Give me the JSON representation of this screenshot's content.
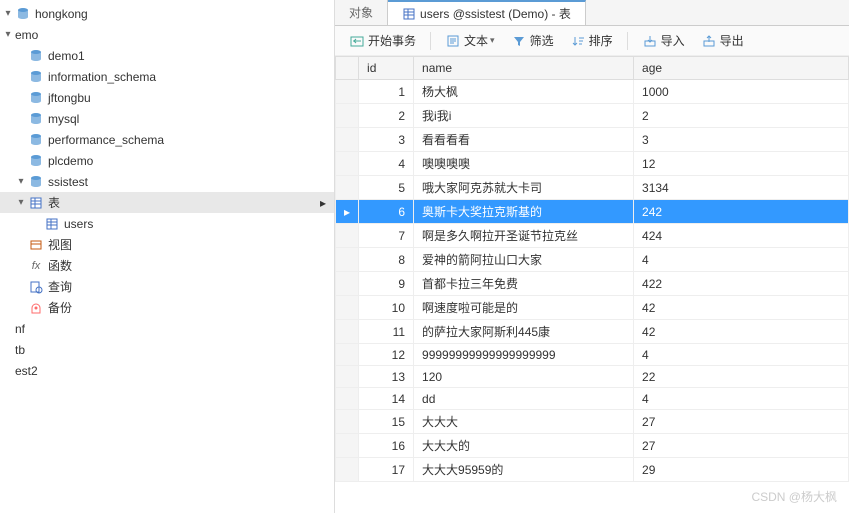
{
  "sidebar": {
    "items": [
      {
        "label": "hongkong",
        "icon": "db",
        "indent": 0,
        "arrow": "▾"
      },
      {
        "label": "emo",
        "icon": "",
        "indent": 0,
        "arrow": "▾"
      },
      {
        "label": "demo1",
        "icon": "db",
        "indent": 1,
        "arrow": ""
      },
      {
        "label": "information_schema",
        "icon": "db",
        "indent": 1,
        "arrow": ""
      },
      {
        "label": "jftongbu",
        "icon": "db",
        "indent": 1,
        "arrow": ""
      },
      {
        "label": "mysql",
        "icon": "db",
        "indent": 1,
        "arrow": ""
      },
      {
        "label": "performance_schema",
        "icon": "db",
        "indent": 1,
        "arrow": ""
      },
      {
        "label": "plcdemo",
        "icon": "db",
        "indent": 1,
        "arrow": ""
      },
      {
        "label": "ssistest",
        "icon": "db",
        "indent": 1,
        "arrow": "▾"
      },
      {
        "label": "表",
        "icon": "table-cat",
        "indent": 1,
        "arrow": "▾",
        "selected": true,
        "indicator": "▸"
      },
      {
        "label": "users",
        "icon": "table-cat",
        "indent": 2,
        "arrow": ""
      },
      {
        "label": "视图",
        "icon": "view",
        "indent": 1,
        "arrow": ""
      },
      {
        "label": "函数",
        "icon": "fx",
        "indent": 1,
        "arrow": ""
      },
      {
        "label": "查询",
        "icon": "query",
        "indent": 1,
        "arrow": ""
      },
      {
        "label": "备份",
        "icon": "backup",
        "indent": 1,
        "arrow": ""
      },
      {
        "label": "nf",
        "icon": "",
        "indent": 0,
        "arrow": ""
      },
      {
        "label": "tb",
        "icon": "",
        "indent": 0,
        "arrow": ""
      },
      {
        "label": "est2",
        "icon": "",
        "indent": 0,
        "arrow": ""
      }
    ]
  },
  "tabs": [
    {
      "label": "对象",
      "active": false
    },
    {
      "label": "users @ssistest (Demo) - 表",
      "active": true
    }
  ],
  "toolbar": {
    "begin_tx": "开始事务",
    "text": "文本",
    "filter": "筛选",
    "sort": "排序",
    "import": "导入",
    "export": "导出"
  },
  "columns": [
    "id",
    "name",
    "age"
  ],
  "rows": [
    {
      "id": "1",
      "name": "杨大枫",
      "age": "1000"
    },
    {
      "id": "2",
      "name": "我i我i",
      "age": "2"
    },
    {
      "id": "3",
      "name": "看看看看",
      "age": "3"
    },
    {
      "id": "4",
      "name": "噢噢噢噢",
      "age": "12"
    },
    {
      "id": "5",
      "name": "哦大家阿克苏就大卡司",
      "age": "3134"
    },
    {
      "id": "6",
      "name": "奥斯卡大奖拉克斯基的",
      "age": "242",
      "selected": true
    },
    {
      "id": "7",
      "name": "啊是多久啊拉开圣诞节拉克丝",
      "age": "424"
    },
    {
      "id": "8",
      "name": "爱神的箭阿拉山口大家",
      "age": "4"
    },
    {
      "id": "9",
      "name": "首都卡拉三年免费",
      "age": "422"
    },
    {
      "id": "10",
      "name": "啊速度啦可能是的",
      "age": "42"
    },
    {
      "id": "11",
      "name": "的萨拉大家阿斯利445康",
      "age": "42"
    },
    {
      "id": "12",
      "name": "99999999999999999999",
      "age": "4"
    },
    {
      "id": "13",
      "name": "120",
      "age": "22"
    },
    {
      "id": "14",
      "name": "dd",
      "age": "4"
    },
    {
      "id": "15",
      "name": "大大大",
      "age": "27"
    },
    {
      "id": "16",
      "name": "大大大的",
      "age": "27"
    },
    {
      "id": "17",
      "name": "大大大95959的",
      "age": "29"
    }
  ],
  "watermark": "CSDN @杨大枫"
}
